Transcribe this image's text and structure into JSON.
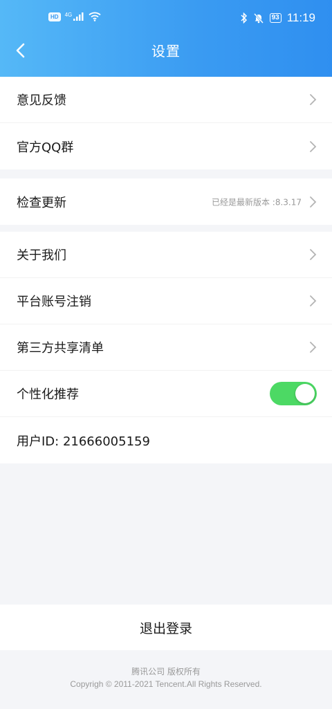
{
  "status_bar": {
    "hd_label": "HD",
    "network_label": "4G",
    "battery": "93",
    "time": "11:19"
  },
  "header": {
    "title": "设置",
    "bg_colors": [
      "#55b8f7",
      "#2f8ff0"
    ]
  },
  "sections": {
    "feedback": {
      "label": "意见反馈"
    },
    "qq_group": {
      "label": "官方QQ群"
    },
    "check_update": {
      "label": "检查更新",
      "value": "已经是最新版本 :8.3.17"
    },
    "about": {
      "label": "关于我们"
    },
    "deregister": {
      "label": "平台账号注销"
    },
    "third_party": {
      "label": "第三方共享清单"
    },
    "personalized": {
      "label": "个性化推荐",
      "enabled": true
    },
    "user_id": {
      "label": "用户ID: 21666005159"
    }
  },
  "logout": {
    "label": "退出登录"
  },
  "footer": {
    "line1": "腾讯公司 版权所有",
    "line2": "Copyrigh © 2011-2021 Tencent.All Rights Reserved."
  },
  "colors": {
    "toggle_on": "#4cd964",
    "page_bg": "#f4f5f8"
  }
}
